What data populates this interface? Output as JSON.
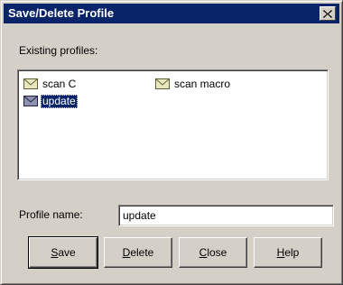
{
  "window": {
    "title": "Save/Delete Profile",
    "close_glyph": "✕"
  },
  "profiles": {
    "label": "Existing profiles:",
    "items": [
      {
        "label": "scan C",
        "icon": "envelope-icon",
        "selected": false
      },
      {
        "label": "scan macro",
        "icon": "envelope-icon",
        "selected": false
      },
      {
        "label": "update",
        "icon": "envelope-icon",
        "selected": true
      }
    ]
  },
  "profile_name": {
    "label": "Profile name:",
    "value": "update"
  },
  "buttons": {
    "save": {
      "mnemonic": "S",
      "rest": "ave"
    },
    "delete": {
      "mnemonic": "D",
      "rest": "elete"
    },
    "close": {
      "mnemonic": "C",
      "rest": "lose"
    },
    "help": {
      "mnemonic": "H",
      "rest": "elp"
    }
  },
  "colors": {
    "face": "#d4d0c8",
    "titlebar": "#0a246a",
    "selection": "#0a246a",
    "envelope": "#c8c878"
  }
}
